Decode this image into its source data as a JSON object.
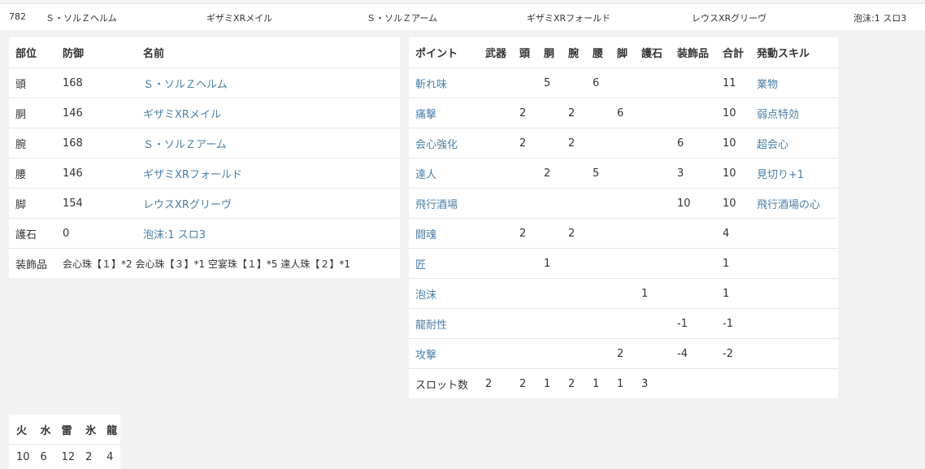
{
  "summary": {
    "defense": "782",
    "head": "Ｓ・ソルＺヘルム",
    "body": "ギザミXRメイル",
    "arm": "Ｓ・ソルＺアーム",
    "waist": "ギザミXRフォールド",
    "leg": "レウスXRグリーヴ",
    "charm": "泡沫:1 スロ3"
  },
  "armor_table": {
    "headers": [
      "部位",
      "防御",
      "名前"
    ],
    "rows": [
      {
        "part": "頭",
        "def": "168",
        "name": "Ｓ・ソルＺヘルム"
      },
      {
        "part": "胴",
        "def": "146",
        "name": "ギザミXRメイル"
      },
      {
        "part": "腕",
        "def": "168",
        "name": "Ｓ・ソルＺアーム"
      },
      {
        "part": "腰",
        "def": "146",
        "name": "ギザミXRフォールド"
      },
      {
        "part": "脚",
        "def": "154",
        "name": "レウスXRグリーヴ"
      },
      {
        "part": "護石",
        "def": "0",
        "name": "泡沫:1 スロ3"
      }
    ],
    "deco_label": "装飾品",
    "deco_value": "会心珠【１】*2 会心珠【３】*1 空宴珠【１】*5 達人珠【２】*1"
  },
  "skill_table": {
    "headers": [
      "ポイント",
      "武器",
      "頭",
      "胴",
      "腕",
      "腰",
      "脚",
      "護石",
      "装飾品",
      "合計",
      "発動スキル"
    ],
    "rows": [
      {
        "point": "斬れ味",
        "weapon": "",
        "head": "",
        "body": "5",
        "arm": "",
        "waist": "6",
        "leg": "",
        "charm": "",
        "deco": "",
        "total": "11",
        "skill": "業物"
      },
      {
        "point": "痛撃",
        "weapon": "",
        "head": "2",
        "body": "",
        "arm": "2",
        "waist": "",
        "leg": "6",
        "charm": "",
        "deco": "",
        "total": "10",
        "skill": "弱点特効"
      },
      {
        "point": "会心強化",
        "weapon": "",
        "head": "2",
        "body": "",
        "arm": "2",
        "waist": "",
        "leg": "",
        "charm": "",
        "deco": "6",
        "total": "10",
        "skill": "超会心"
      },
      {
        "point": "達人",
        "weapon": "",
        "head": "",
        "body": "2",
        "arm": "",
        "waist": "5",
        "leg": "",
        "charm": "",
        "deco": "3",
        "total": "10",
        "skill": "見切り+1"
      },
      {
        "point": "飛行酒場",
        "weapon": "",
        "head": "",
        "body": "",
        "arm": "",
        "waist": "",
        "leg": "",
        "charm": "",
        "deco": "10",
        "total": "10",
        "skill": "飛行酒場の心"
      },
      {
        "point": "闘魂",
        "weapon": "",
        "head": "2",
        "body": "",
        "arm": "2",
        "waist": "",
        "leg": "",
        "charm": "",
        "deco": "",
        "total": "4",
        "skill": ""
      },
      {
        "point": "匠",
        "weapon": "",
        "head": "",
        "body": "1",
        "arm": "",
        "waist": "",
        "leg": "",
        "charm": "",
        "deco": "",
        "total": "1",
        "skill": ""
      },
      {
        "point": "泡沫",
        "weapon": "",
        "head": "",
        "body": "",
        "arm": "",
        "waist": "",
        "leg": "",
        "charm": "1",
        "deco": "",
        "total": "1",
        "skill": ""
      },
      {
        "point": "龍耐性",
        "weapon": "",
        "head": "",
        "body": "",
        "arm": "",
        "waist": "",
        "leg": "",
        "charm": "",
        "deco": "-1",
        "total": "-1",
        "skill": ""
      },
      {
        "point": "攻撃",
        "weapon": "",
        "head": "",
        "body": "",
        "arm": "",
        "waist": "",
        "leg": "2",
        "charm": "",
        "deco": "-4",
        "total": "-2",
        "skill": ""
      }
    ],
    "slot_row": {
      "label": "スロット数",
      "weapon": "2",
      "head": "2",
      "body": "1",
      "arm": "2",
      "waist": "1",
      "leg": "1",
      "charm": "3"
    }
  },
  "elements": {
    "headers": [
      "火",
      "水",
      "雷",
      "氷",
      "龍"
    ],
    "values": [
      "10",
      "6",
      "12",
      "2",
      "4"
    ]
  }
}
